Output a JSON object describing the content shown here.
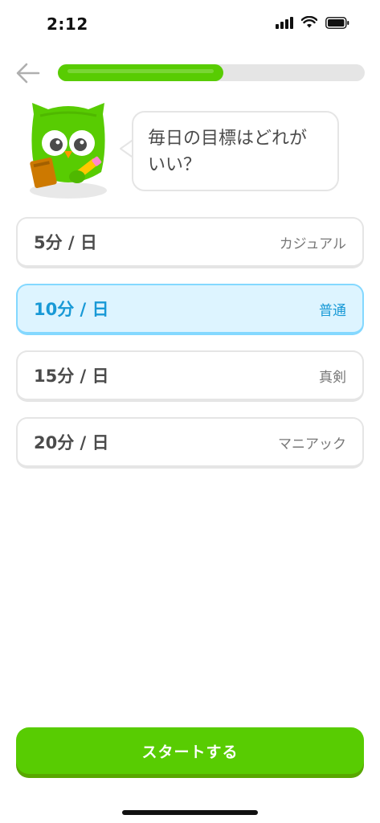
{
  "status_bar": {
    "time": "2:12",
    "icons": [
      "signal-icon",
      "wifi-icon",
      "battery-icon"
    ]
  },
  "header": {
    "back_icon": "arrow-left-icon",
    "progress_fraction": 0.54
  },
  "mascot": {
    "name": "owl-mascot",
    "speech": "毎日の目標はどれがいい？"
  },
  "goal_options": [
    {
      "time": "5分 / 日",
      "level": "カジュアル",
      "selected": false
    },
    {
      "time": "10分 / 日",
      "level": "普通",
      "selected": true
    },
    {
      "time": "15分 / 日",
      "level": "真剣",
      "selected": false
    },
    {
      "time": "20分 / 日",
      "level": "マニアック",
      "selected": false
    }
  ],
  "footer": {
    "start_label": "スタートする"
  },
  "colors": {
    "brand_green": "#58cc02",
    "selected_blue": "#1899d6",
    "selected_bg": "#ddf4ff"
  }
}
